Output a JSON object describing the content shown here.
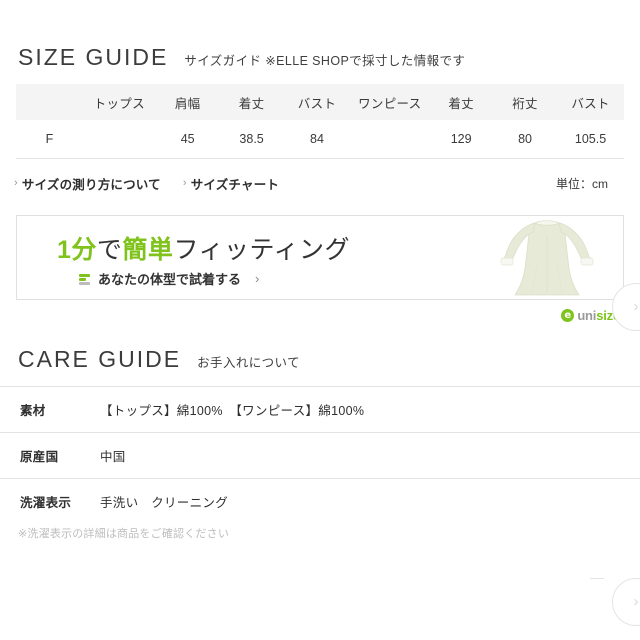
{
  "size_guide": {
    "title": "SIZE GUIDE",
    "subtitle": "サイズガイド ※ELLE SHOPで採寸した情報です",
    "headers": [
      "",
      "トップス",
      "肩幅",
      "着丈",
      "バスト",
      "ワンピース",
      "着丈",
      "裄丈",
      "バスト"
    ],
    "rows": [
      {
        "size": "F",
        "cells": [
          "",
          "45",
          "38.5",
          "84",
          "",
          "129",
          "80",
          "105.5"
        ]
      }
    ],
    "links": [
      {
        "label": "サイズの測り方について",
        "chevron": "›"
      },
      {
        "label": "サイズチャート",
        "chevron": "›"
      }
    ],
    "unit_note": "単位：cm"
  },
  "fitting_banner": {
    "headline_parts": [
      {
        "text": "1分",
        "accent": true
      },
      {
        "text": "で",
        "accent": false
      },
      {
        "text": "簡単",
        "accent": true
      },
      {
        "text": "フィッティング",
        "accent": false
      }
    ],
    "headline_full": "1分で簡単フィッティング",
    "cta_label": "あなたの体型で試着する",
    "cta_chevron": "›",
    "icon_name": "bars-icon",
    "dress_icon_name": "dress-illustration",
    "accent_color": "#7fc31c",
    "dress_color": "#e6e9d5"
  },
  "unisize_logo": {
    "mark": "e",
    "word_gray": "uni",
    "word_green": "size",
    "green": "#7fc31c",
    "gray": "#9a9a9a"
  },
  "care_guide": {
    "title": "CARE GUIDE",
    "subtitle": "お手入れについて",
    "rows": [
      {
        "label": "素材",
        "value": "【トップス】綿100%　【ワンピース】綿100%"
      },
      {
        "label": "原産国",
        "value": "中国"
      },
      {
        "label": "洗濯表示",
        "value": "手洗い　クリーニング"
      }
    ],
    "note": "※洗濯表示の詳細は商品をご確認ください"
  },
  "edge_controls": {
    "top_glyph": "›",
    "bottom_glyph": "›"
  }
}
